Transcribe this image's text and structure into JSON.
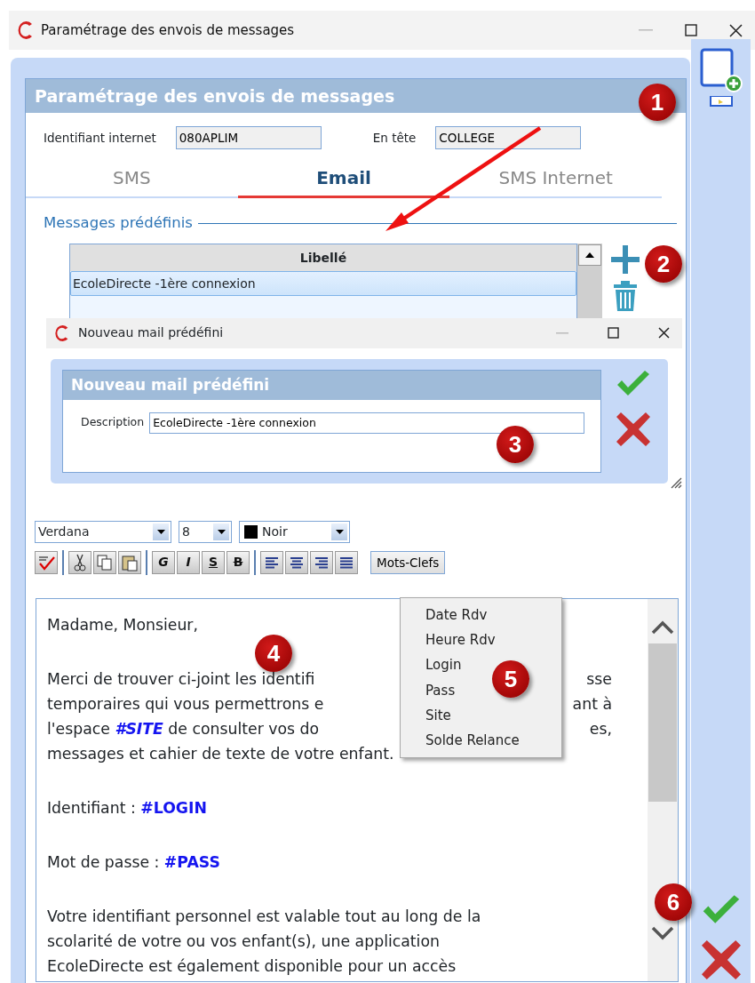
{
  "window": {
    "title": "Paramétrage des envois de messages"
  },
  "panel_title": "Paramétrage des envois de messages",
  "fields": [
    {
      "label": "Identifiant internet",
      "value": "080APLIM"
    },
    {
      "label": "En tête",
      "value": "COLLEGE"
    }
  ],
  "tabs": [
    {
      "label": "SMS",
      "selected": false
    },
    {
      "label": "Email",
      "selected": true
    },
    {
      "label": "SMS Internet",
      "selected": false
    }
  ],
  "predefined": {
    "legend": "Messages prédéfinis",
    "column": "Libellé",
    "rows": [
      {
        "label": "EcoleDirecte -1ère connexion",
        "selected": true
      }
    ]
  },
  "dialog": {
    "title": "Nouveau mail prédéfini",
    "header": "Nouveau mail prédéfini",
    "field_label": "Description",
    "field_value": "EcoleDirecte -1ère connexion"
  },
  "toolbar": {
    "font": "Verdana",
    "size": "8",
    "color_name": "Noir",
    "format_buttons": [
      {
        "label": "G",
        "kind": "bold"
      },
      {
        "label": "I",
        "kind": "italic"
      },
      {
        "label": "S",
        "kind": "underline"
      },
      {
        "label": "B",
        "kind": "strike"
      }
    ],
    "keywords_button": "Mots-Clefs"
  },
  "keywords_menu": [
    "Date Rdv",
    "Heure Rdv",
    "Login",
    "Pass",
    "Site",
    "Solde Relance"
  ],
  "editor": {
    "lines": [
      {
        "segments": [
          {
            "text": "Madame, Monsieur,",
            "kind": "plain"
          }
        ]
      },
      {
        "kind": "blank"
      },
      {
        "segments": [
          {
            "text": "Merci de trouver ci-joint les identifi",
            "kind": "plain"
          }
        ],
        "tail": "sse"
      },
      {
        "segments": [
          {
            "text": "temporaires qui vous permettrons e",
            "kind": "plain"
          }
        ],
        "tail": "ant à"
      },
      {
        "segments": [
          {
            "text": "l'espace ",
            "kind": "plain"
          },
          {
            "text": "#SITE",
            "kind": "keyword",
            "italic": true
          },
          {
            "text": " de consulter vos do",
            "kind": "plain"
          }
        ],
        "tail": "es,"
      },
      {
        "segments": [
          {
            "text": "messages et cahier de texte de votre enfant.",
            "kind": "plain"
          }
        ]
      },
      {
        "kind": "blank"
      },
      {
        "segments": [
          {
            "text": "Identifiant : ",
            "kind": "plain"
          },
          {
            "text": "#LOGIN",
            "kind": "keyword",
            "italic": false
          }
        ]
      },
      {
        "kind": "blank"
      },
      {
        "segments": [
          {
            "text": "Mot de passe : ",
            "kind": "plain"
          },
          {
            "text": "#PASS",
            "kind": "keyword",
            "italic": false
          }
        ]
      },
      {
        "kind": "blank"
      },
      {
        "segments": [
          {
            "text": "Votre identifiant personnel est valable tout au long de la",
            "kind": "plain"
          }
        ]
      },
      {
        "segments": [
          {
            "text": "scolarité de votre ou vos enfant(s), une application",
            "kind": "plain"
          }
        ]
      },
      {
        "segments": [
          {
            "text": "EcoleDirecte est également disponible pour un accès",
            "kind": "plain"
          }
        ]
      }
    ]
  },
  "annotations": [
    "1",
    "2",
    "3",
    "4",
    "5",
    "6"
  ]
}
